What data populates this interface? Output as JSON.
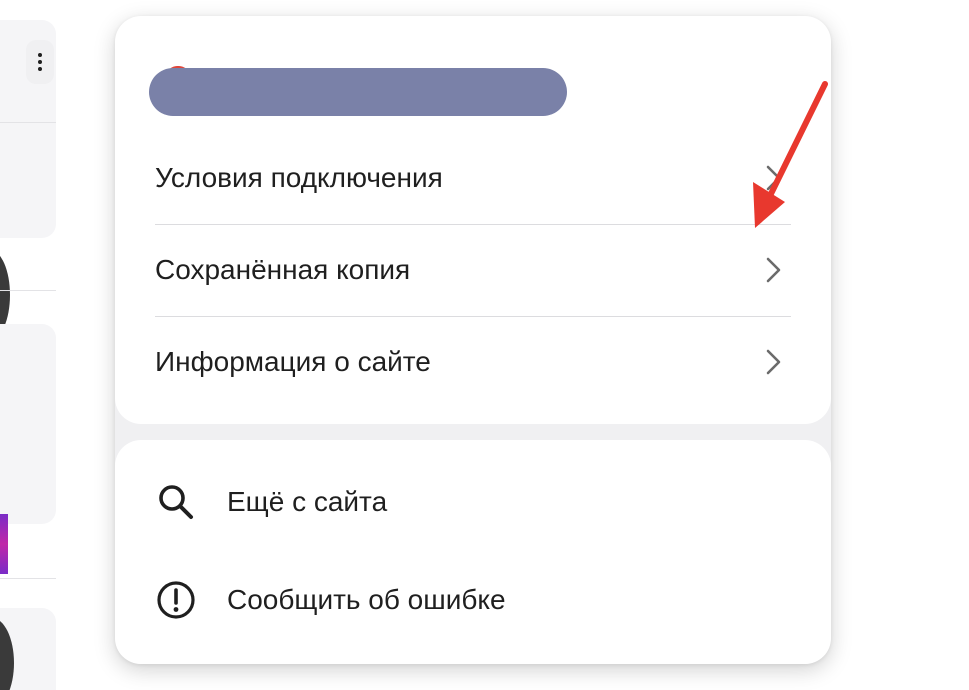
{
  "popup": {
    "menu_items": [
      {
        "label": "Условия подключения"
      },
      {
        "label": "Сохранённая копия"
      },
      {
        "label": "Информация о сайте"
      }
    ],
    "actions": [
      {
        "label": "Ещё с сайта",
        "icon": "search-icon"
      },
      {
        "label": "Сообщить об ошибке",
        "icon": "alert-circle-icon"
      }
    ]
  },
  "colors": {
    "annotation_arrow": "#e8382e",
    "redaction": "#7a81a8"
  }
}
